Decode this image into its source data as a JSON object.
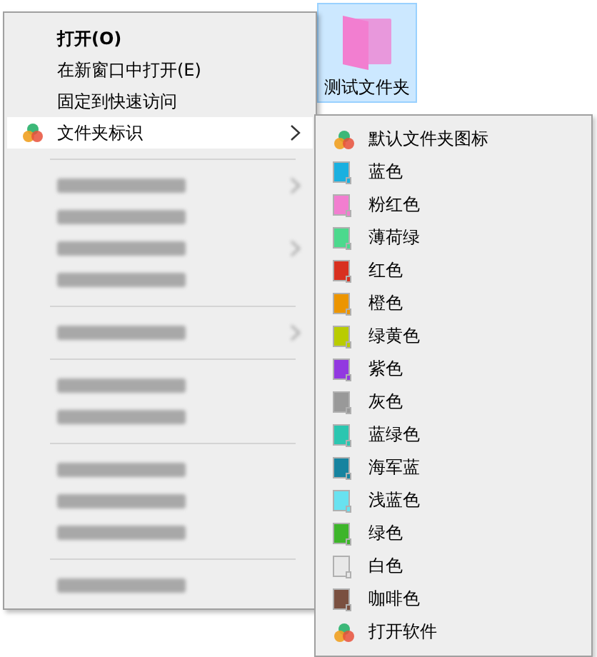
{
  "desktop_item": {
    "label": "测试文件夹",
    "color": "#f27ed0",
    "selected": true
  },
  "context_menu": {
    "groups": [
      [
        {
          "label": "打开(O)",
          "kind": "plain",
          "bold": true,
          "submenu": false,
          "selected": false
        },
        {
          "label": "在新窗口中打开(E)",
          "kind": "plain",
          "bold": false,
          "submenu": false,
          "selected": false
        },
        {
          "label": "固定到快速访问",
          "kind": "plain",
          "bold": false,
          "submenu": false,
          "selected": false
        },
        {
          "label": "文件夹标识",
          "kind": "app",
          "bold": false,
          "submenu": true,
          "selected": true
        }
      ],
      [
        {
          "kind": "redacted",
          "submenu": true
        },
        {
          "kind": "redacted"
        },
        {
          "kind": "redacted",
          "submenu": true
        },
        {
          "kind": "redacted"
        }
      ],
      [
        {
          "kind": "redacted",
          "submenu": true
        }
      ],
      [
        {
          "kind": "redacted"
        },
        {
          "kind": "redacted"
        }
      ],
      [
        {
          "kind": "redacted"
        },
        {
          "kind": "redacted"
        },
        {
          "kind": "redacted"
        }
      ],
      [
        {
          "kind": "redacted"
        }
      ]
    ]
  },
  "submenu": {
    "items": [
      {
        "label": "默认文件夹图标",
        "kind": "app"
      },
      {
        "label": "蓝色",
        "kind": "color",
        "color": "#1ab0e0"
      },
      {
        "label": "粉红色",
        "kind": "color",
        "color": "#f27ed0"
      },
      {
        "label": "薄荷绿",
        "kind": "color",
        "color": "#4cd98d"
      },
      {
        "label": "红色",
        "kind": "color",
        "color": "#d8301f"
      },
      {
        "label": "橙色",
        "kind": "color",
        "color": "#ec9500"
      },
      {
        "label": "绿黄色",
        "kind": "color",
        "color": "#b9cc00"
      },
      {
        "label": "紫色",
        "kind": "color",
        "color": "#9238e0"
      },
      {
        "label": "灰色",
        "kind": "color",
        "color": "#999999"
      },
      {
        "label": "蓝绿色",
        "kind": "color",
        "color": "#2bc6b0"
      },
      {
        "label": "海军蓝",
        "kind": "color",
        "color": "#16839f"
      },
      {
        "label": "浅蓝色",
        "kind": "color",
        "color": "#68e2f0"
      },
      {
        "label": "绿色",
        "kind": "color",
        "color": "#3db52a"
      },
      {
        "label": "白色",
        "kind": "color",
        "color": "#e8e8e8"
      },
      {
        "label": "咖啡色",
        "kind": "color",
        "color": "#7a5040"
      },
      {
        "label": "打开软件",
        "kind": "app"
      }
    ]
  }
}
